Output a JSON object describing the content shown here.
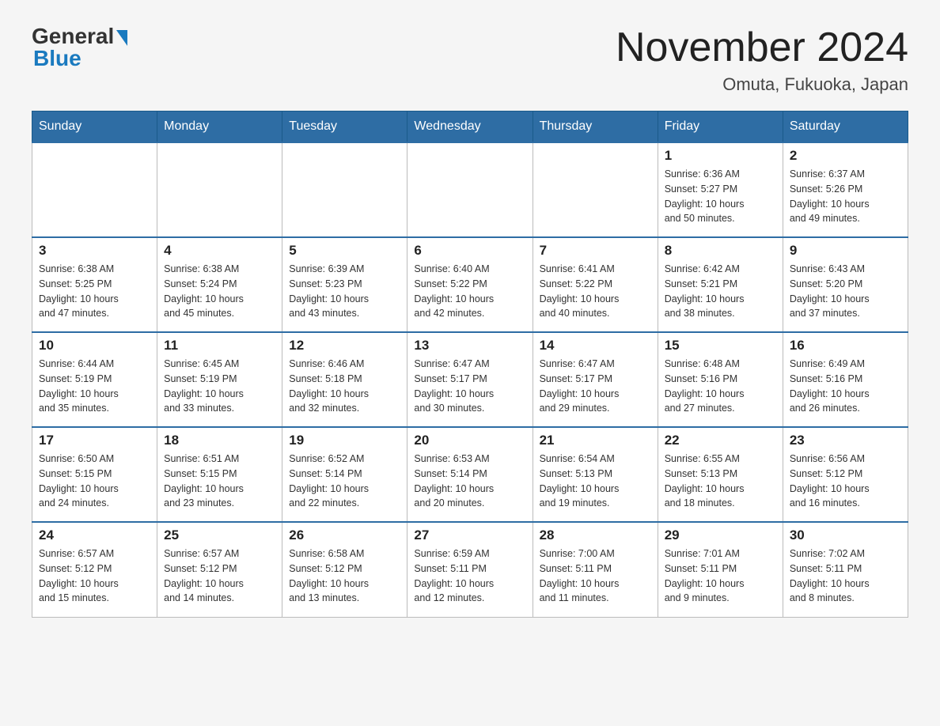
{
  "header": {
    "logo_general": "General",
    "logo_blue": "Blue",
    "month_title": "November 2024",
    "location": "Omuta, Fukuoka, Japan"
  },
  "weekdays": [
    "Sunday",
    "Monday",
    "Tuesday",
    "Wednesday",
    "Thursday",
    "Friday",
    "Saturday"
  ],
  "weeks": [
    [
      {
        "day": "",
        "info": ""
      },
      {
        "day": "",
        "info": ""
      },
      {
        "day": "",
        "info": ""
      },
      {
        "day": "",
        "info": ""
      },
      {
        "day": "",
        "info": ""
      },
      {
        "day": "1",
        "info": "Sunrise: 6:36 AM\nSunset: 5:27 PM\nDaylight: 10 hours\nand 50 minutes."
      },
      {
        "day": "2",
        "info": "Sunrise: 6:37 AM\nSunset: 5:26 PM\nDaylight: 10 hours\nand 49 minutes."
      }
    ],
    [
      {
        "day": "3",
        "info": "Sunrise: 6:38 AM\nSunset: 5:25 PM\nDaylight: 10 hours\nand 47 minutes."
      },
      {
        "day": "4",
        "info": "Sunrise: 6:38 AM\nSunset: 5:24 PM\nDaylight: 10 hours\nand 45 minutes."
      },
      {
        "day": "5",
        "info": "Sunrise: 6:39 AM\nSunset: 5:23 PM\nDaylight: 10 hours\nand 43 minutes."
      },
      {
        "day": "6",
        "info": "Sunrise: 6:40 AM\nSunset: 5:22 PM\nDaylight: 10 hours\nand 42 minutes."
      },
      {
        "day": "7",
        "info": "Sunrise: 6:41 AM\nSunset: 5:22 PM\nDaylight: 10 hours\nand 40 minutes."
      },
      {
        "day": "8",
        "info": "Sunrise: 6:42 AM\nSunset: 5:21 PM\nDaylight: 10 hours\nand 38 minutes."
      },
      {
        "day": "9",
        "info": "Sunrise: 6:43 AM\nSunset: 5:20 PM\nDaylight: 10 hours\nand 37 minutes."
      }
    ],
    [
      {
        "day": "10",
        "info": "Sunrise: 6:44 AM\nSunset: 5:19 PM\nDaylight: 10 hours\nand 35 minutes."
      },
      {
        "day": "11",
        "info": "Sunrise: 6:45 AM\nSunset: 5:19 PM\nDaylight: 10 hours\nand 33 minutes."
      },
      {
        "day": "12",
        "info": "Sunrise: 6:46 AM\nSunset: 5:18 PM\nDaylight: 10 hours\nand 32 minutes."
      },
      {
        "day": "13",
        "info": "Sunrise: 6:47 AM\nSunset: 5:17 PM\nDaylight: 10 hours\nand 30 minutes."
      },
      {
        "day": "14",
        "info": "Sunrise: 6:47 AM\nSunset: 5:17 PM\nDaylight: 10 hours\nand 29 minutes."
      },
      {
        "day": "15",
        "info": "Sunrise: 6:48 AM\nSunset: 5:16 PM\nDaylight: 10 hours\nand 27 minutes."
      },
      {
        "day": "16",
        "info": "Sunrise: 6:49 AM\nSunset: 5:16 PM\nDaylight: 10 hours\nand 26 minutes."
      }
    ],
    [
      {
        "day": "17",
        "info": "Sunrise: 6:50 AM\nSunset: 5:15 PM\nDaylight: 10 hours\nand 24 minutes."
      },
      {
        "day": "18",
        "info": "Sunrise: 6:51 AM\nSunset: 5:15 PM\nDaylight: 10 hours\nand 23 minutes."
      },
      {
        "day": "19",
        "info": "Sunrise: 6:52 AM\nSunset: 5:14 PM\nDaylight: 10 hours\nand 22 minutes."
      },
      {
        "day": "20",
        "info": "Sunrise: 6:53 AM\nSunset: 5:14 PM\nDaylight: 10 hours\nand 20 minutes."
      },
      {
        "day": "21",
        "info": "Sunrise: 6:54 AM\nSunset: 5:13 PM\nDaylight: 10 hours\nand 19 minutes."
      },
      {
        "day": "22",
        "info": "Sunrise: 6:55 AM\nSunset: 5:13 PM\nDaylight: 10 hours\nand 18 minutes."
      },
      {
        "day": "23",
        "info": "Sunrise: 6:56 AM\nSunset: 5:12 PM\nDaylight: 10 hours\nand 16 minutes."
      }
    ],
    [
      {
        "day": "24",
        "info": "Sunrise: 6:57 AM\nSunset: 5:12 PM\nDaylight: 10 hours\nand 15 minutes."
      },
      {
        "day": "25",
        "info": "Sunrise: 6:57 AM\nSunset: 5:12 PM\nDaylight: 10 hours\nand 14 minutes."
      },
      {
        "day": "26",
        "info": "Sunrise: 6:58 AM\nSunset: 5:12 PM\nDaylight: 10 hours\nand 13 minutes."
      },
      {
        "day": "27",
        "info": "Sunrise: 6:59 AM\nSunset: 5:11 PM\nDaylight: 10 hours\nand 12 minutes."
      },
      {
        "day": "28",
        "info": "Sunrise: 7:00 AM\nSunset: 5:11 PM\nDaylight: 10 hours\nand 11 minutes."
      },
      {
        "day": "29",
        "info": "Sunrise: 7:01 AM\nSunset: 5:11 PM\nDaylight: 10 hours\nand 9 minutes."
      },
      {
        "day": "30",
        "info": "Sunrise: 7:02 AM\nSunset: 5:11 PM\nDaylight: 10 hours\nand 8 minutes."
      }
    ]
  ]
}
